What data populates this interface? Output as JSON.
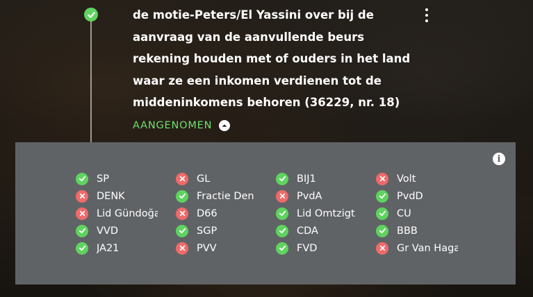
{
  "motion": {
    "status_icon": "check-icon",
    "text": "de motie-Peters/El Yassini over bij de aanvraag van de aanvullende beurs rekening houden met of ouders in het land waar ze een inkomen verdienen tot de middeninkomens behoren (36229, nr. 18)",
    "result": "AANGENOMEN"
  },
  "colors": {
    "for": "#5fd35f",
    "against": "#f06a6a",
    "result_text": "#6fe06f",
    "panel": "#606366"
  },
  "votes": [
    {
      "party": "SP",
      "vote": "for"
    },
    {
      "party": "GL",
      "vote": "against"
    },
    {
      "party": "BIJ1",
      "vote": "for"
    },
    {
      "party": "Volt",
      "vote": "against"
    },
    {
      "party": "DENK",
      "vote": "against"
    },
    {
      "party": "Fractie Den Haan",
      "vote": "for"
    },
    {
      "party": "PvdA",
      "vote": "against"
    },
    {
      "party": "PvdD",
      "vote": "for"
    },
    {
      "party": "Lid Gündoğan",
      "vote": "against"
    },
    {
      "party": "D66",
      "vote": "against"
    },
    {
      "party": "Lid Omtzigt",
      "vote": "for"
    },
    {
      "party": "CU",
      "vote": "for"
    },
    {
      "party": "VVD",
      "vote": "for"
    },
    {
      "party": "SGP",
      "vote": "for"
    },
    {
      "party": "CDA",
      "vote": "for"
    },
    {
      "party": "BBB",
      "vote": "for"
    },
    {
      "party": "JA21",
      "vote": "for"
    },
    {
      "party": "PVV",
      "vote": "against"
    },
    {
      "party": "FVD",
      "vote": "for"
    },
    {
      "party": "Gr Van Haga",
      "vote": "against"
    }
  ]
}
